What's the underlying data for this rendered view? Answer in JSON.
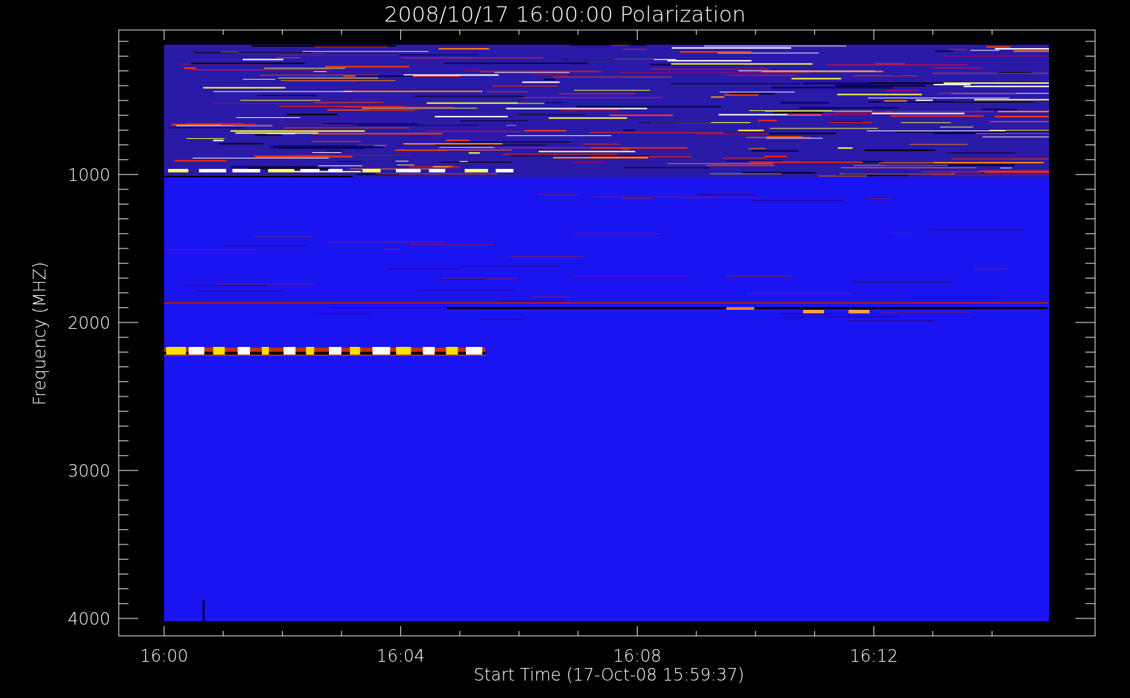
{
  "title": "2008/10/17 16:00:00 Polarization",
  "xlabel": "Start Time (17-Oct-08 15:59:37)",
  "ylabel": "Frequency (MHZ)",
  "xticks": [
    "16:00",
    "16:04",
    "16:08",
    "16:12"
  ],
  "yticks": [
    "1000",
    "2000",
    "3000",
    "4000"
  ]
}
